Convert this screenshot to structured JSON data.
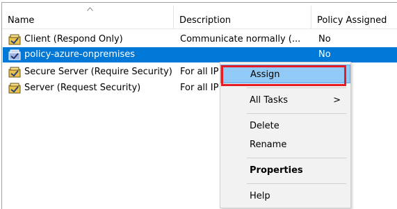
{
  "header": {
    "columns": [
      "Name",
      "Description",
      "Policy Assigned"
    ]
  },
  "rows": [
    {
      "name": "Client (Respond Only)",
      "description": "Communicate normally (...",
      "assigned": "No"
    },
    {
      "name": "policy-azure-onpremises",
      "description": "",
      "assigned": "No"
    },
    {
      "name": "Secure Server (Require Security)",
      "description": "For all IP",
      "assigned": ""
    },
    {
      "name": "Server (Request Security)",
      "description": "For all IP",
      "assigned": ""
    }
  ],
  "context_menu": {
    "assign": "Assign",
    "all_tasks": "All Tasks",
    "all_tasks_arrow": ">",
    "delete": "Delete",
    "rename": "Rename",
    "properties": "Properties",
    "help": "Help"
  },
  "colors": {
    "selection": "#0078d7",
    "menu_highlight": "#91c9f7",
    "annotation_box": "#e51c23"
  },
  "icons": {
    "policy_icon": "policy-shield-icon",
    "sort": "sort-ascending-icon"
  }
}
